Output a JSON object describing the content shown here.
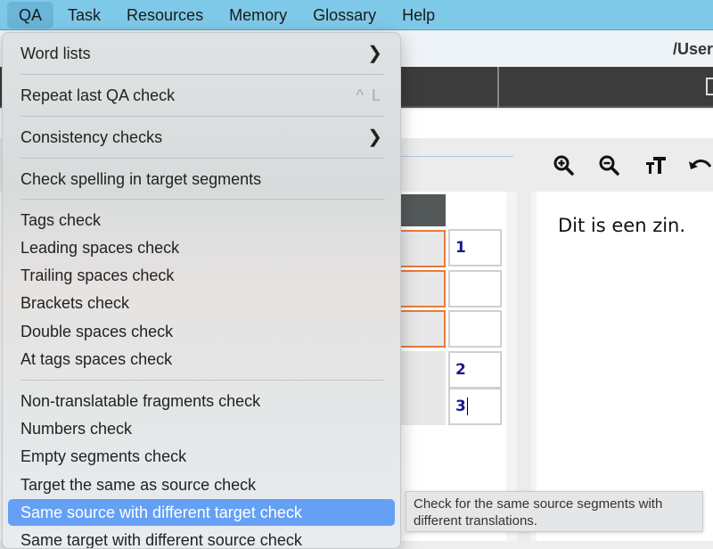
{
  "menubar": {
    "items": [
      "QA",
      "Task",
      "Resources",
      "Memory",
      "Glossary",
      "Help"
    ],
    "active": "QA"
  },
  "titlebar": {
    "path": "/User"
  },
  "toolbar": {
    "icons": [
      "zoom-in-icon",
      "zoom-out-icon",
      "font-size-icon",
      "undo-icon"
    ]
  },
  "segments": {
    "numbers": [
      "1",
      "",
      "",
      "2",
      "3"
    ]
  },
  "target_pane": {
    "text": "Dit is een zin."
  },
  "qa_menu": {
    "word_lists": "Word lists",
    "repeat_last": "Repeat last QA check",
    "repeat_shortcut": "^ L",
    "consistency": "Consistency checks",
    "spelling": "Check spelling in target segments",
    "tags": "Tags check",
    "leading": "Leading spaces check",
    "trailing": "Trailing spaces check",
    "brackets": "Brackets check",
    "double": "Double spaces check",
    "at_tags": "At tags spaces check",
    "non_translatable": "Non-translatable fragments check",
    "numbers": "Numbers check",
    "empty": "Empty segments check",
    "target_same": "Target the same as source check",
    "same_source": "Same source with different target check",
    "same_target": "Same target with different source check",
    "highlighted": "Same source with different target check"
  },
  "tooltip": {
    "text": "Check for the same source segments with different translations."
  },
  "colors": {
    "menubar_bg": "#7fc9e8",
    "highlight": "#65a0f5",
    "segment_border_active": "#e87a3a",
    "segment_number": "#1a1a8c"
  }
}
